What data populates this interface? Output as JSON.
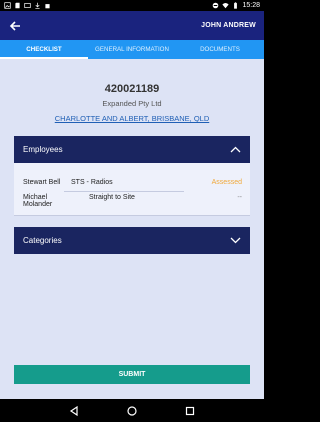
{
  "status_bar": {
    "time": "15:28",
    "icons_left": [
      "image-icon",
      "sd-card-icon",
      "cast-icon",
      "download-icon",
      "shopping-bag-icon"
    ],
    "icons_right": [
      "do-not-disturb-icon",
      "wifi-icon",
      "battery-icon"
    ]
  },
  "app_bar": {
    "back_icon": "arrow-left-icon",
    "user_name": "JOHN ANDREW"
  },
  "tabs": [
    {
      "label": "CHECKLIST",
      "active": true
    },
    {
      "label": "GENERAL INFORMATION",
      "active": false
    },
    {
      "label": "DOCUMENTS",
      "active": false
    }
  ],
  "job": {
    "number": "420021189",
    "company": "Expanded Pty Ltd",
    "address": "CHARLOTTE AND ALBERT, BRISBANE, QLD"
  },
  "employees_section": {
    "title": "Employees",
    "expanded": true,
    "rows": [
      {
        "name": "Stewart Bell",
        "role": "STS - Radios",
        "status": "Assessed"
      },
      {
        "name": "Michael Molander",
        "role": "Straight to Site",
        "status": "--"
      }
    ]
  },
  "categories_section": {
    "title": "Categories",
    "expanded": false
  },
  "submit_label": "SUBMIT",
  "colors": {
    "app_bar": "#1a237e",
    "tab_bar": "#2196f3",
    "section_header": "#1a2560",
    "background": "#dde3f5",
    "submit": "#159c8c",
    "assessed": "#f0a93b",
    "link": "#1f5fb5"
  }
}
